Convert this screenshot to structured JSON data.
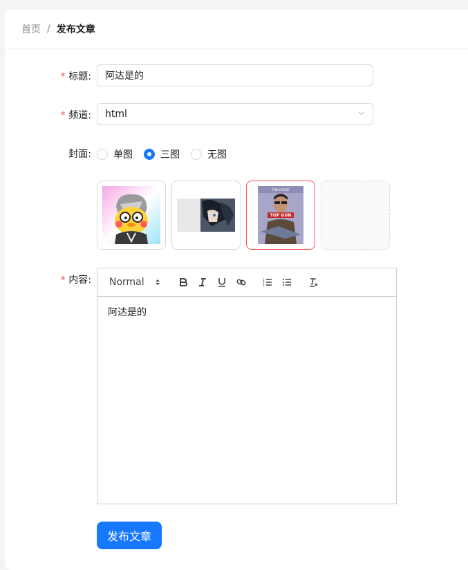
{
  "breadcrumb": {
    "home": "首页",
    "separator": "/",
    "current": "发布文章"
  },
  "form": {
    "title": {
      "required_mark": "*",
      "label": "标题:",
      "value": "阿达是的"
    },
    "channel": {
      "required_mark": "*",
      "label": "频道:",
      "value": "html"
    },
    "cover": {
      "label": "封面:",
      "options": [
        {
          "label": "单图",
          "checked": false
        },
        {
          "label": "三图",
          "checked": true
        },
        {
          "label": "无图",
          "checked": false
        }
      ]
    },
    "content": {
      "required_mark": "*",
      "label": "内容:",
      "text": "阿达是的",
      "toolbar": {
        "format_select": "Normal",
        "buttons": [
          "bold-icon",
          "italic-icon",
          "underline-icon",
          "link-icon",
          "ordered-list-icon",
          "bullet-list-icon",
          "clear-format-icon"
        ]
      }
    },
    "submit_label": "发布文章"
  },
  "colors": {
    "primary": "#1677ff",
    "required": "#ff4d4f",
    "active_thumb_border": "#ff4d4f"
  }
}
